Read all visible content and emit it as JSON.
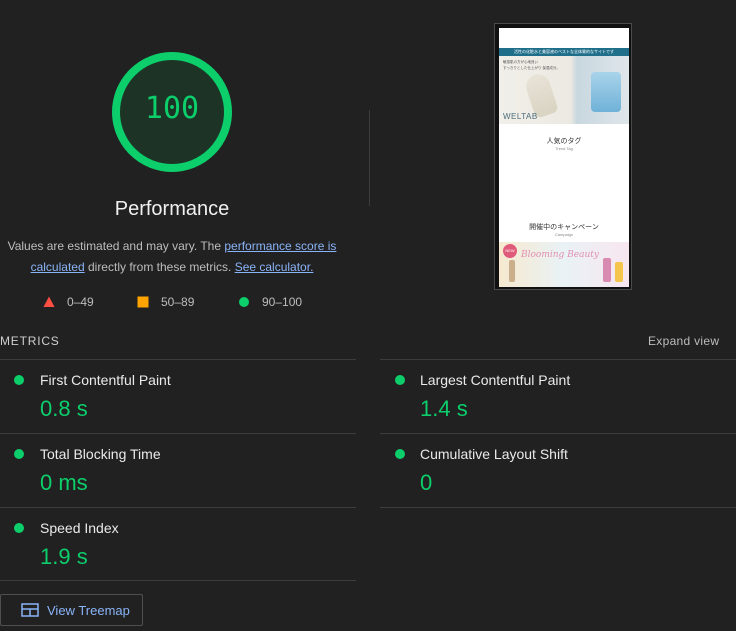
{
  "score": {
    "value": "100",
    "fraction": 1.0,
    "category": "Performance",
    "color": "#0cce6b"
  },
  "description": {
    "prefix": "Values are estimated and may vary. The ",
    "link1": "performance score is calculated",
    "middle": " directly from these metrics. ",
    "link2": "See calculator."
  },
  "legend": [
    {
      "range": "0–49",
      "shape": "triangle",
      "color": "#ff4e42"
    },
    {
      "range": "50–89",
      "shape": "square",
      "color": "#ffa400"
    },
    {
      "range": "90–100",
      "shape": "circle",
      "color": "#0cce6b"
    }
  ],
  "screenshot": {
    "banner": "活性の化粧水と美容液のベストな全体質的なサイトです",
    "hero_line1": "敏感肌の方が心地良い",
    "hero_line2": "すっきりとした仕上がり 保湿成分。",
    "brand": "WELTAB",
    "tag_title": "人気のタグ",
    "tag_sub": "Trend Tag",
    "campaign_title": "開催中のキャンペーン",
    "campaign_sub": "Campaign",
    "new_badge": "NEW",
    "campaign_script": "Blooming Beauty"
  },
  "metrics": {
    "title": "METRICS",
    "expand": "Expand view",
    "items": [
      {
        "name": "First Contentful Paint",
        "value": "0.8 s"
      },
      {
        "name": "Largest Contentful Paint",
        "value": "1.4 s"
      },
      {
        "name": "Total Blocking Time",
        "value": "0 ms"
      },
      {
        "name": "Cumulative Layout Shift",
        "value": "0"
      },
      {
        "name": "Speed Index",
        "value": "1.9 s"
      }
    ]
  },
  "treemap": {
    "label": "View Treemap"
  }
}
